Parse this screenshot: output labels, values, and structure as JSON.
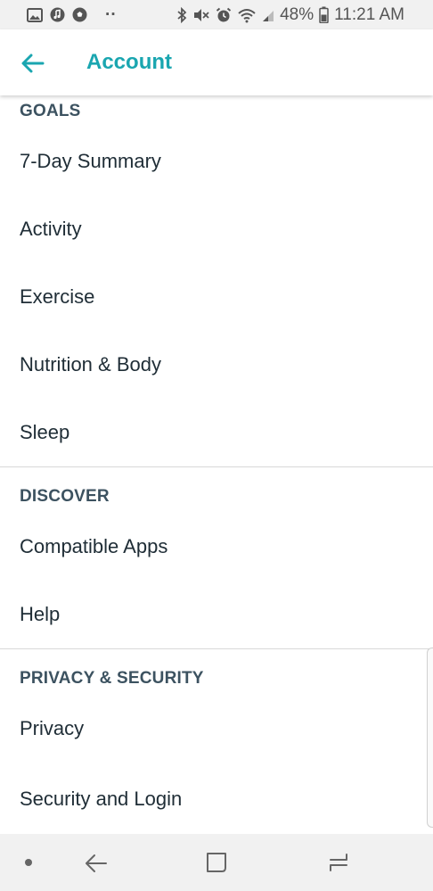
{
  "status_bar": {
    "battery": "48%",
    "time": "11:21 AM",
    "dots": "··",
    "icons": [
      "gallery-icon",
      "music-icon",
      "soccer-ball-icon",
      "bluetooth-icon",
      "mute-icon",
      "alarm-icon",
      "wifi-icon",
      "signal-icon",
      "battery-icon"
    ]
  },
  "app_bar": {
    "title": "Account",
    "back_icon": "arrow-left-icon",
    "accent_color": "#1aa6b0"
  },
  "sections": {
    "goals": {
      "header": "GOALS",
      "items": [
        "7-Day Summary",
        "Activity",
        "Exercise",
        "Nutrition & Body",
        "Sleep"
      ]
    },
    "discover": {
      "header": "DISCOVER",
      "items": [
        "Compatible Apps",
        "Help"
      ]
    },
    "privacy": {
      "header": "PRIVACY & SECURITY",
      "items": [
        "Privacy",
        "Security and Login"
      ]
    }
  },
  "nav_bar": {
    "icons": [
      "dot-icon",
      "back-nav-icon",
      "recent-apps-icon",
      "overview-icon"
    ]
  }
}
